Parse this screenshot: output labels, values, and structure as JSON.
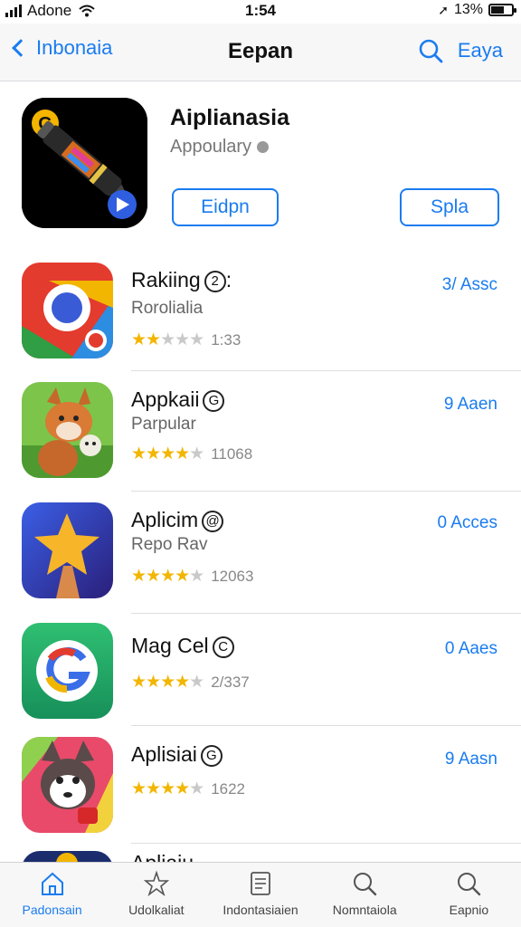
{
  "status": {
    "carrier": "Adone",
    "time": "1:54",
    "battery": "13%"
  },
  "nav": {
    "back_label": "Inbonaia",
    "title": "Eepan",
    "right_label": "Eaya"
  },
  "featured": {
    "name": "Aiplianasia",
    "subtitle": "Appoulary",
    "button_1": "Eidpn",
    "button_2": "Spla"
  },
  "list": [
    {
      "name": "Rakiing",
      "badge": "2",
      "subtitle": "Rorolialia",
      "rating": 2.5,
      "rating_count": "1:33",
      "price": "3/ Assc",
      "icon": "chrome-style-icon"
    },
    {
      "name": "Appkaii",
      "badge": "G",
      "subtitle": "Parpular",
      "rating": 4.5,
      "rating_count": "11068",
      "price": "9 Aaen",
      "icon": "fox-character-icon"
    },
    {
      "name": "Aplicim",
      "badge": "@",
      "subtitle": "Repo Rav",
      "rating": 4.5,
      "rating_count": "12063",
      "price": "0 Acces",
      "icon": "star-icon"
    },
    {
      "name": "Mag Cel",
      "badge": "C",
      "subtitle": "",
      "rating": 4.5,
      "rating_count": "2/337",
      "price": "0 Aaes",
      "icon": "google-g-icon"
    },
    {
      "name": "Aplisiai",
      "badge": "G",
      "subtitle": "",
      "rating": 4.5,
      "rating_count": "1622",
      "price": "9 Aasn",
      "icon": "husky-character-icon"
    },
    {
      "name": "Apliaiu",
      "badge": "",
      "subtitle": "",
      "rating": 0,
      "rating_count": "",
      "price": "",
      "icon": "partial-app-icon"
    }
  ],
  "tabs": [
    {
      "label": "Padonsain",
      "icon": "home-icon"
    },
    {
      "label": "Udolkaliat",
      "icon": "star-outline-icon"
    },
    {
      "label": "Indontasiaien",
      "icon": "document-icon"
    },
    {
      "label": "Nomntaiola",
      "icon": "search-icon"
    },
    {
      "label": "Eapnio",
      "icon": "search-icon"
    }
  ],
  "colors": {
    "accent": "#1a7cf0",
    "star": "#f2b600"
  }
}
